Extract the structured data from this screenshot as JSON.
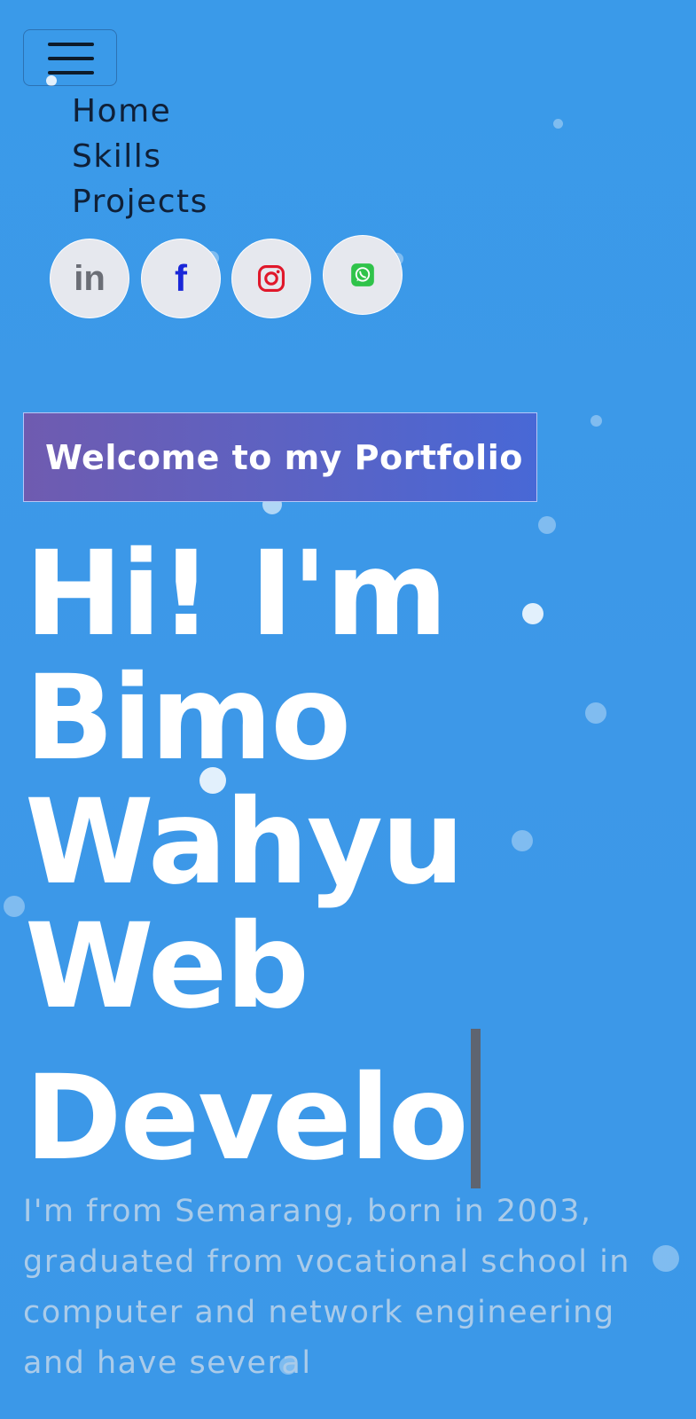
{
  "nav": {
    "menu_icon": "hamburger-menu-icon",
    "items": [
      "Home",
      "Skills",
      "Projects"
    ]
  },
  "socials": [
    {
      "name": "linkedin",
      "icon": "linkedin-icon",
      "glyph": "in",
      "color": "#6b6e76"
    },
    {
      "name": "facebook",
      "icon": "facebook-icon",
      "glyph": "f",
      "color": "#1a27d8"
    },
    {
      "name": "instagram",
      "icon": "instagram-icon",
      "color": "#e0172a"
    },
    {
      "name": "whatsapp",
      "icon": "whatsapp-icon",
      "color": "#2fc34a"
    }
  ],
  "hero": {
    "badge": "Welcome to my Portfolio",
    "lines": [
      "Hi! I'm",
      "Bimo",
      "Wahyu",
      "Web",
      "Develo"
    ]
  },
  "bio": {
    "text": "I'm from Semarang, born in 2003, graduated from vocational school in computer and network engineering and have several"
  },
  "colors": {
    "background": "#3a9ae9",
    "badge_gradient_start": "#6f5bb0",
    "badge_gradient_end": "#4868d6",
    "bio_text": "#aacbe9",
    "typing_cursor": "#5e6470"
  }
}
